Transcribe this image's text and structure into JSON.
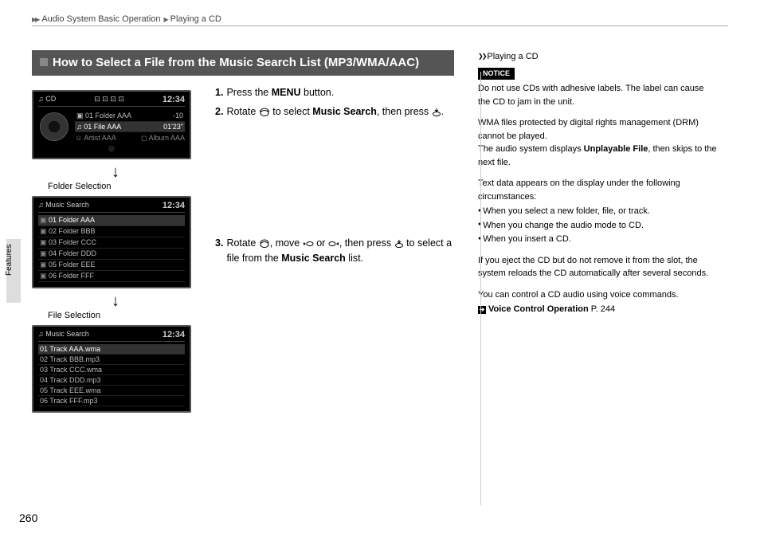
{
  "breadcrumb": {
    "a": "Audio System Basic Operation",
    "b": "Playing a CD"
  },
  "section_title": "How to Select a File from the Music Search List (MP3/WMA/AAC)",
  "side_tab": "Features",
  "page_number": "260",
  "steps": {
    "s1": {
      "num": "1.",
      "a": "Press the ",
      "b": "MENU",
      "c": " button."
    },
    "s2": {
      "num": "2.",
      "a": "Rotate ",
      "b": " to select ",
      "c": "Music Search",
      "d": ", then press ",
      "e": "."
    },
    "s3": {
      "num": "3.",
      "a": "Rotate ",
      "b": ", move ",
      "c": " or ",
      "d": ", then press ",
      "e": " to select a file from the ",
      "f": "Music Search",
      "g": " list."
    }
  },
  "captions": {
    "folder": "Folder Selection",
    "file": "File Selection"
  },
  "screen1": {
    "title_left": "♫  CD",
    "title_mid": "⊡ ⊡ ⊡ ⊡",
    "clock": "12:34",
    "line1": "▣ 01  Folder AAA",
    "line2_left": "♫ 01 File AAA",
    "line2_neg": "-10",
    "line2_time": "01'23\"",
    "artist": "☺ Artist AAA",
    "album": "◻ Album AAA",
    "disc_icon": "◎"
  },
  "screen2": {
    "title_left": "♫  Music Search",
    "clock": "12:34",
    "rows": [
      "01 Folder AAA",
      "02 Folder BBB",
      "03 Folder CCC",
      "04 Folder DDD",
      "05 Folder EEE",
      "06 Folder FFF"
    ]
  },
  "screen3": {
    "title_left": "♫  Music Search",
    "clock": "12:34",
    "rows": [
      "01 Track AAA.wma",
      "02 Track BBB.mp3",
      "03 Track CCC.wma",
      "04 Track DDD.mp3",
      "05 Track EEE.wma",
      "06 Track FFF.mp3"
    ]
  },
  "sidebar": {
    "heading": "Playing a CD",
    "notice_label": "NOTICE",
    "notice_text": "Do not use CDs with adhesive labels. The label can cause the CD to jam in the unit.",
    "drm1": "WMA files protected by digital rights management (DRM) cannot be played.",
    "drm2a": "The audio system displays ",
    "drm2b": "Unplayable File",
    "drm2c": ", then skips to the next file.",
    "textintro": "Text data appears on the display under the following circumstances:",
    "bullets": [
      "When you select a new folder, file, or track.",
      "When you change the audio mode to CD.",
      "When you insert a CD."
    ],
    "eject": "If you eject the CD but do not remove it from the slot, the system reloads the CD automatically after several seconds.",
    "voice": "You can control a CD audio using voice commands.",
    "link_label": "Voice Control Operation",
    "link_page": " P. 244"
  }
}
